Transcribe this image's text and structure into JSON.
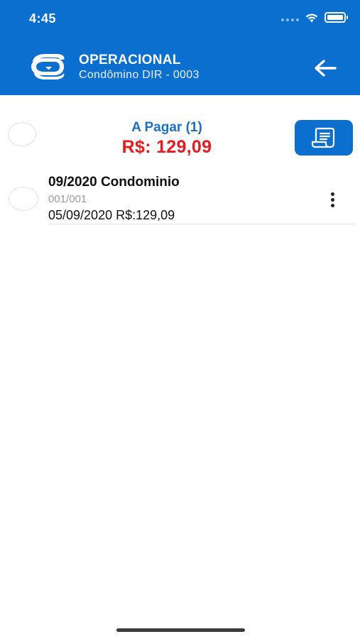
{
  "status_bar": {
    "time": "4:45"
  },
  "header": {
    "title": "OPERACIONAL",
    "subtitle": "Condômino DIR - 0003",
    "logo_icon": "logo-icon",
    "back_icon": "arrow-left-icon",
    "background_color": "#0a6fce"
  },
  "summary": {
    "label": "A Pagar (1)",
    "amount": "R$: 129,09",
    "label_color": "#1c6fc4",
    "amount_color": "#e6191f",
    "action_icon": "receipt-icon"
  },
  "items": [
    {
      "title": "09/2020 Condominio",
      "installment": "001/001",
      "detail": "05/09/2020 R$:129,09",
      "menu_icon": "more-vertical-icon"
    }
  ]
}
